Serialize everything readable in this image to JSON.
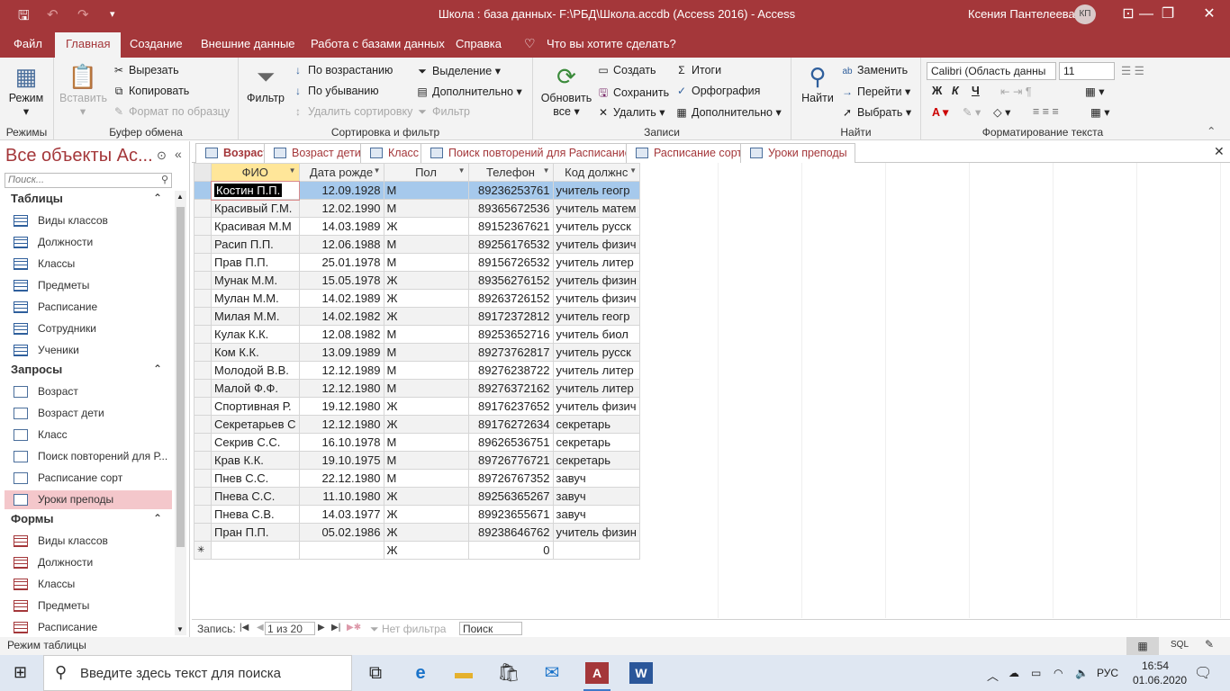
{
  "window": {
    "title": "Школа : база данных- F:\\РБД\\Школа.accdb (Access 2016)  -  Access",
    "user": "Ксения Пантелеева",
    "initials": "КП"
  },
  "ribbon_tabs": [
    "Файл",
    "Главная",
    "Создание",
    "Внешние данные",
    "Работа с базами данных",
    "Справка",
    "Что вы хотите сделать?"
  ],
  "groups": {
    "views": {
      "label": "Режимы",
      "mode": "Режим"
    },
    "clipboard": {
      "label": "Буфер обмена",
      "paste": "Вставить",
      "cut": "Вырезать",
      "copy": "Копировать",
      "format": "Формат по образцу"
    },
    "sort": {
      "label": "Сортировка и фильтр",
      "filter": "Фильтр",
      "asc": "По возрастанию",
      "desc": "По убыванию",
      "remove": "Удалить сортировку",
      "selection": "Выделение",
      "advanced": "Дополнительно",
      "toggle": "Фильтр"
    },
    "records": {
      "label": "Записи",
      "refresh1": "Обновить",
      "refresh2": "все",
      "create": "Создать",
      "save": "Сохранить",
      "delete": "Удалить",
      "totals": "Итоги",
      "spelling": "Орфография",
      "more": "Дополнительно"
    },
    "find": {
      "label": "Найти",
      "find": "Найти",
      "replace": "Заменить",
      "goto": "Перейти",
      "select": "Выбрать"
    },
    "text": {
      "label": "Форматирование текста",
      "font": "Calibri (Область данны",
      "size": "11",
      "bold": "Ж",
      "italic": "К",
      "underline": "Ч"
    }
  },
  "nav": {
    "title": "Все объекты Ac...",
    "search_placeholder": "Поиск...",
    "sections": [
      {
        "title": "Таблицы",
        "items": [
          "Виды классов",
          "Должности",
          "Классы",
          "Предметы",
          "Расписание",
          "Сотрудники",
          "Ученики"
        ]
      },
      {
        "title": "Запросы",
        "items": [
          "Возраст",
          "Возраст дети",
          "Класс",
          "Поиск повторений для Р...",
          "Расписание сорт",
          "Уроки преподы"
        ]
      },
      {
        "title": "Формы",
        "items": [
          "Виды классов",
          "Должности",
          "Классы",
          "Предметы",
          "Расписание"
        ]
      }
    ]
  },
  "doc_tabs": [
    "Возраст",
    "Возраст дети",
    "Класс",
    "Поиск повторений для Расписание",
    "Расписание сорт",
    "Уроки преподы"
  ],
  "grid": {
    "columns": [
      "ФИО",
      "Дата рожде",
      "Пол",
      "Телефон",
      "Код должнс"
    ],
    "rows": [
      [
        "Костин П.П.",
        "12.09.1928",
        "М",
        "89236253761",
        "учитель геогр"
      ],
      [
        "Красивый Г.М.",
        "12.02.1990",
        "М",
        "89365672536",
        "учитель матем"
      ],
      [
        "Красивая М.М",
        "14.03.1989",
        "Ж",
        "89152367621",
        "учитель русск"
      ],
      [
        "Расип П.П.",
        "12.06.1988",
        "М",
        "89256176532",
        "учитель физич"
      ],
      [
        "Прав П.П.",
        "25.01.1978",
        "М",
        "89156726532",
        "учитель литер"
      ],
      [
        "Мунак М.М.",
        "15.05.1978",
        "Ж",
        "89356276152",
        "учитель физин"
      ],
      [
        "Мулан М.М.",
        "14.02.1989",
        "Ж",
        "89263726152",
        "учитель физич"
      ],
      [
        "Милая М.М.",
        "14.02.1982",
        "Ж",
        "89172372812",
        "учитель геогр"
      ],
      [
        "Кулак К.К.",
        "12.08.1982",
        "М",
        "89253652716",
        "учитель биол"
      ],
      [
        "Ком К.К.",
        "13.09.1989",
        "М",
        "89273762817",
        "учитель русск"
      ],
      [
        "Молодой В.В.",
        "12.12.1989",
        "М",
        "89276238722",
        "учитель литер"
      ],
      [
        "Малой Ф.Ф.",
        "12.12.1980",
        "М",
        "89276372162",
        "учитель литер"
      ],
      [
        "Спортивная Р.",
        "19.12.1980",
        "Ж",
        "89176237652",
        "учитель физич"
      ],
      [
        "Секретарьев С",
        "12.12.1980",
        "Ж",
        "89176272634",
        "секретарь"
      ],
      [
        "Секрив С.С.",
        "16.10.1978",
        "М",
        "89626536751",
        "секретарь"
      ],
      [
        "Крав К.К.",
        "19.10.1975",
        "М",
        "89726776721",
        "секретарь"
      ],
      [
        "Пнев С.С.",
        "22.12.1980",
        "М",
        "89726767352",
        "завуч"
      ],
      [
        "Пнева С.С.",
        "11.10.1980",
        "Ж",
        "89256365267",
        "завуч"
      ],
      [
        "Пнева С.В.",
        "14.03.1977",
        "Ж",
        "89923655671",
        "завуч"
      ],
      [
        "Пран П.П.",
        "05.02.1986",
        "Ж",
        "89238646762",
        "учитель физин"
      ]
    ],
    "new_row": [
      "",
      "",
      "Ж",
      "0",
      ""
    ]
  },
  "recnav": {
    "label": "Запись:",
    "position": "1 из 20",
    "filter": "Нет фильтра",
    "search": "Поиск"
  },
  "status": {
    "mode": "Режим таблицы",
    "sql": "SQL"
  },
  "taskbar": {
    "search": "Введите здесь текст для поиска",
    "lang": "РУС",
    "time": "16:54",
    "date": "01.06.2020"
  }
}
